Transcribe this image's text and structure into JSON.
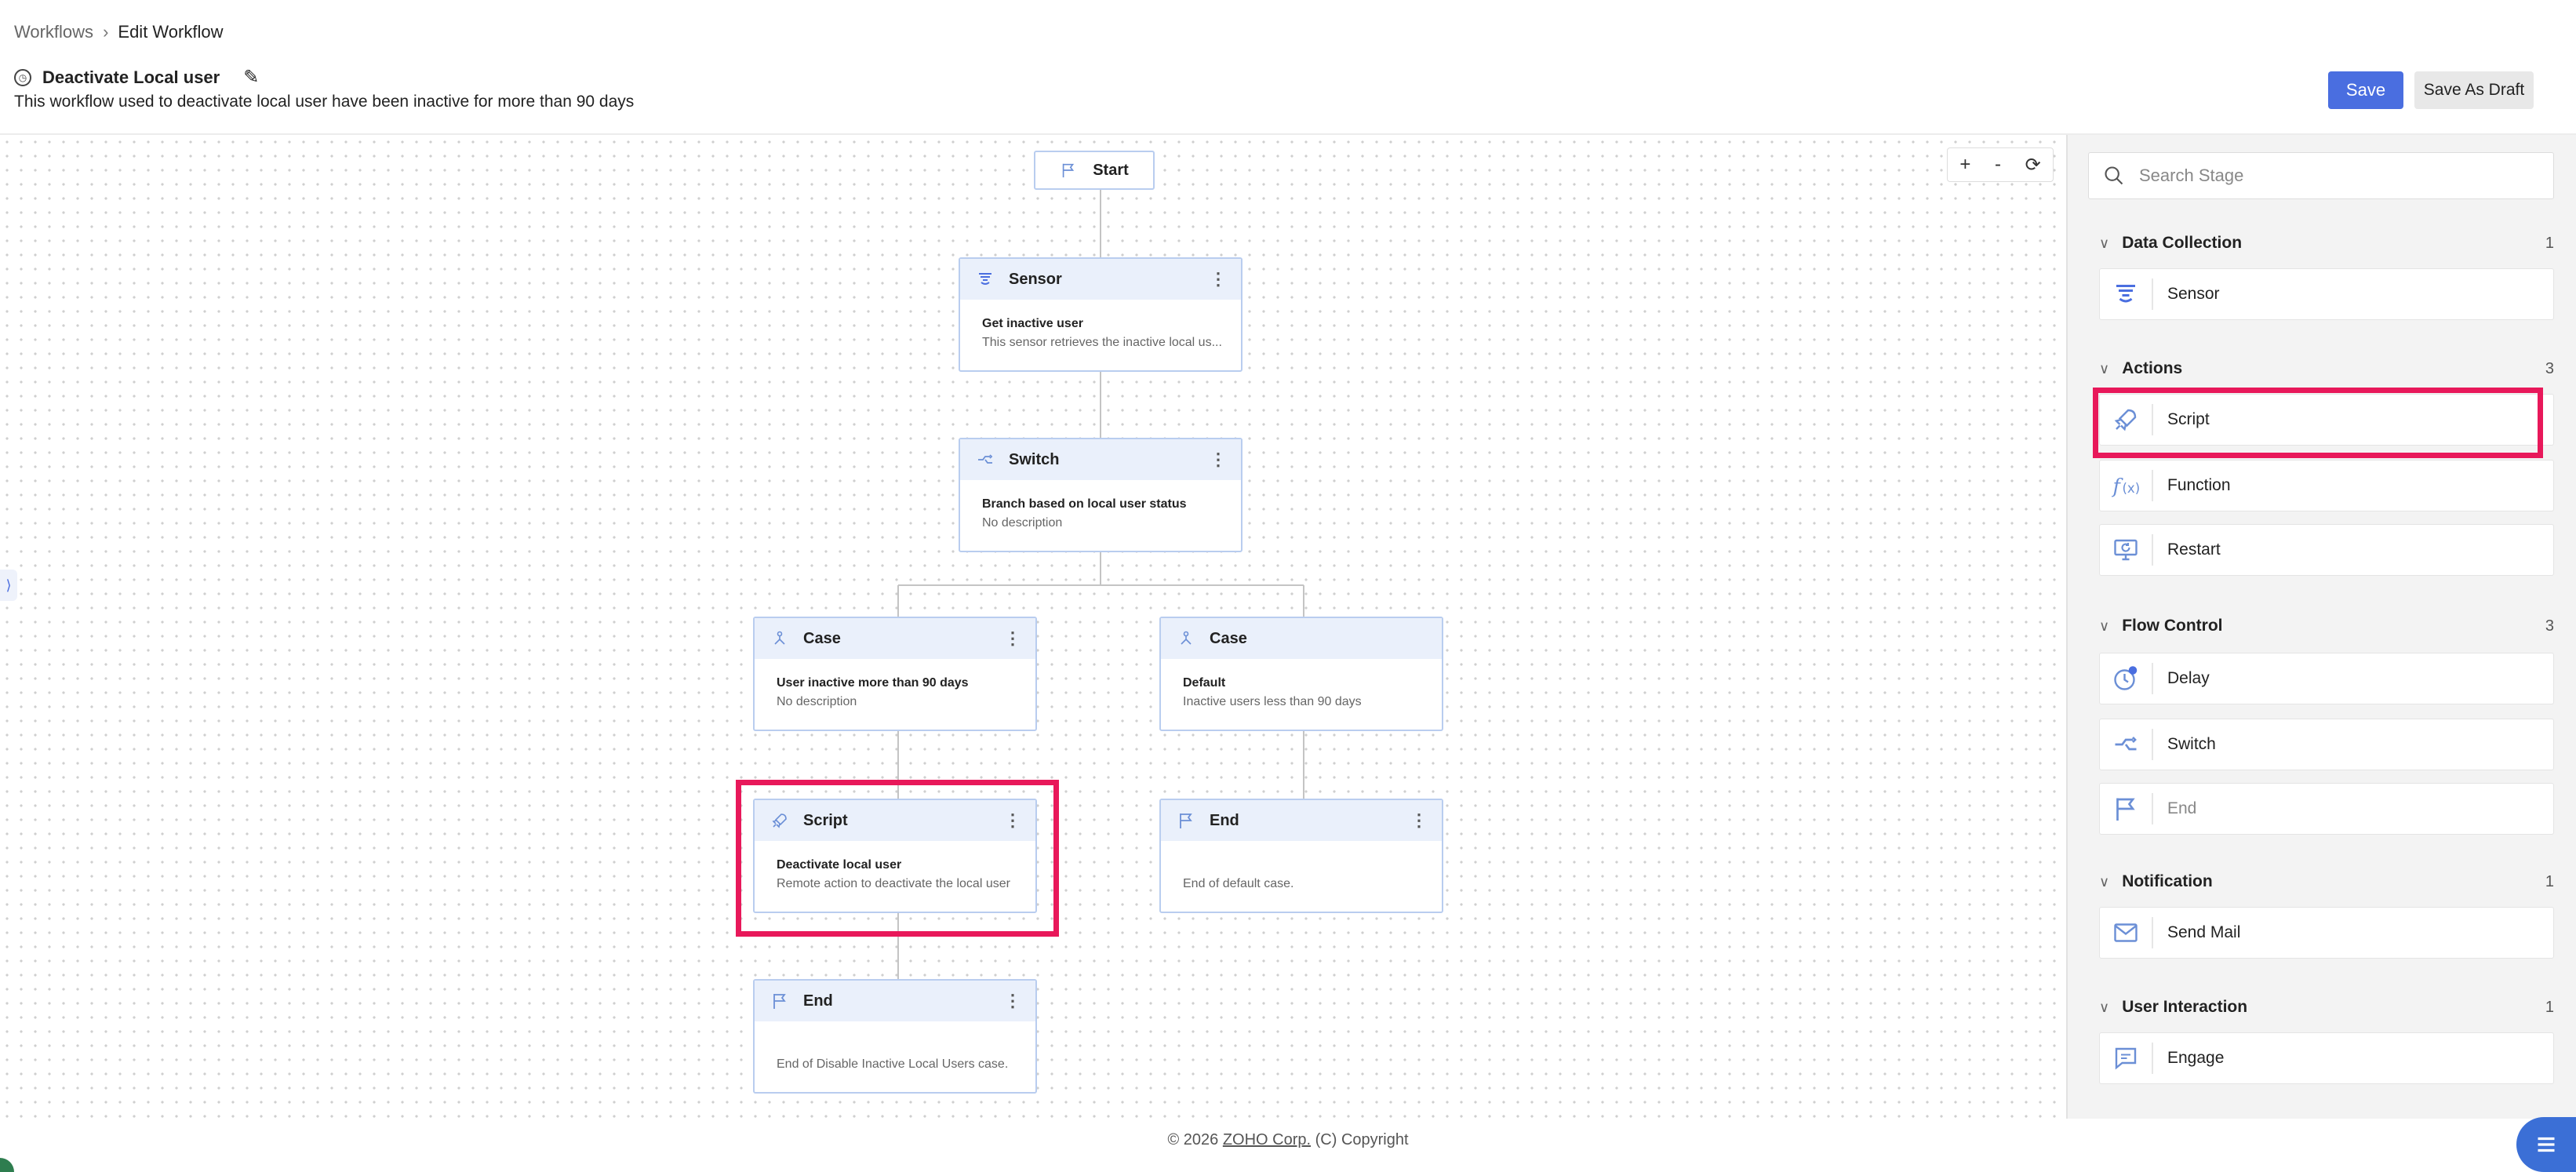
{
  "breadcrumb": {
    "root": "Workflows",
    "current": "Edit Workflow"
  },
  "workflow": {
    "title": "Deactivate Local user",
    "description": "This workflow used to deactivate local user have been inactive for more than 90 days"
  },
  "actions": {
    "save": "Save",
    "save_draft": "Save As Draft"
  },
  "canvas": {
    "zoom": {
      "in": "+",
      "out": "-",
      "reset": "⟳"
    },
    "start_label": "Start",
    "nodes": [
      {
        "type": "Sensor",
        "name": "Get inactive user",
        "desc": "This sensor retrieves the inactive local us..."
      },
      {
        "type": "Switch",
        "name": "Branch based on local user status",
        "desc": "No description"
      },
      {
        "type": "Case",
        "name": "User inactive more than 90 days",
        "desc": "No description"
      },
      {
        "type": "Case",
        "name": "Default",
        "desc": "Inactive users less than 90 days"
      },
      {
        "type": "Script",
        "name": "Deactivate local user",
        "desc": "Remote action to deactivate the local user"
      },
      {
        "type": "End",
        "name": "",
        "desc": "End of default case."
      },
      {
        "type": "End",
        "name": "",
        "desc": "End of Disable Inactive Local Users case."
      }
    ]
  },
  "panel": {
    "search_placeholder": "Search Stage",
    "categories": [
      {
        "name": "Data Collection",
        "count": "1",
        "items": [
          {
            "label": "Sensor",
            "icon": "sensor-icon"
          }
        ]
      },
      {
        "name": "Actions",
        "count": "3",
        "items": [
          {
            "label": "Script",
            "icon": "rocket-icon"
          },
          {
            "label": "Function",
            "icon": "function-icon"
          },
          {
            "label": "Restart",
            "icon": "restart-icon"
          }
        ]
      },
      {
        "name": "Flow Control",
        "count": "3",
        "items": [
          {
            "label": "Delay",
            "icon": "clock-icon"
          },
          {
            "label": "Switch",
            "icon": "switch-icon"
          },
          {
            "label": "End",
            "icon": "flag-icon"
          }
        ]
      },
      {
        "name": "Notification",
        "count": "1",
        "items": [
          {
            "label": "Send Mail",
            "icon": "mail-icon"
          }
        ]
      },
      {
        "name": "User Interaction",
        "count": "1",
        "items": [
          {
            "label": "Engage",
            "icon": "chat-icon"
          }
        ]
      }
    ]
  },
  "footer": {
    "year": "© 2026",
    "company": "ZOHO Corp.",
    "rights": "(C) Copyright"
  },
  "colors": {
    "accent": "#4a6ee0",
    "highlight": "#e8185a",
    "node_border": "#b9cdef",
    "node_header": "#eaf0fb"
  }
}
